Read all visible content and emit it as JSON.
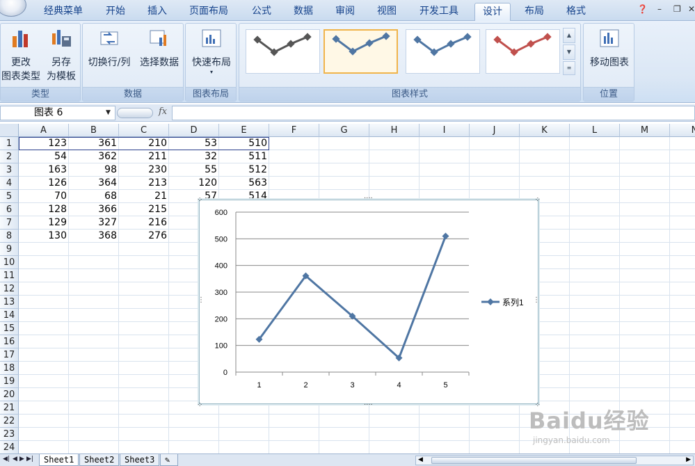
{
  "tabs": [
    "经典菜单",
    "开始",
    "插入",
    "页面布局",
    "公式",
    "数据",
    "审阅",
    "视图",
    "开发工具",
    "设计",
    "布局",
    "格式"
  ],
  "active_tab": "设计",
  "ribbon": {
    "type_group": {
      "label": "类型",
      "change_type": [
        "更改",
        "图表类型"
      ],
      "save_template": [
        "另存",
        "为模板"
      ]
    },
    "data_group": {
      "label": "数据",
      "switch_row_col": "切换行/列",
      "select_data": "选择数据"
    },
    "layout_group": {
      "label": "图表布局",
      "quick_layout": "快速布局"
    },
    "styles_group": {
      "label": "图表样式"
    },
    "location_group": {
      "label": "位置",
      "move_chart": "移动图表"
    }
  },
  "formula_bar": {
    "name_box": "图表 6",
    "fx": "fx"
  },
  "columns": [
    "A",
    "B",
    "C",
    "D",
    "E",
    "F",
    "G",
    "H",
    "I",
    "J",
    "K",
    "L",
    "M",
    "N"
  ],
  "rows": [
    "1",
    "2",
    "3",
    "4",
    "5",
    "6",
    "7",
    "8",
    "9",
    "10",
    "11",
    "12",
    "13",
    "14",
    "15",
    "16",
    "17",
    "18",
    "19",
    "20",
    "21",
    "22",
    "23",
    "24"
  ],
  "cells": [
    [
      "123",
      "361",
      "210",
      "53",
      "510"
    ],
    [
      "54",
      "362",
      "211",
      "32",
      "511"
    ],
    [
      "163",
      "98",
      "230",
      "55",
      "512"
    ],
    [
      "126",
      "364",
      "213",
      "120",
      "563"
    ],
    [
      "70",
      "68",
      "21",
      "57",
      "514"
    ],
    [
      "128",
      "366",
      "215",
      "",
      ""
    ],
    [
      "129",
      "327",
      "216",
      "",
      ""
    ],
    [
      "130",
      "368",
      "276",
      "",
      ""
    ]
  ],
  "chart_data": {
    "type": "line",
    "categories": [
      "1",
      "2",
      "3",
      "4",
      "5"
    ],
    "series": [
      {
        "name": "系列1",
        "values": [
          123,
          361,
          210,
          53,
          510
        ]
      }
    ],
    "ylim": [
      0,
      600
    ],
    "yticks": [
      "0",
      "100",
      "200",
      "300",
      "400",
      "500",
      "600"
    ],
    "grid": true,
    "legend": "right",
    "line_color": "#4f76a3"
  },
  "sheets": [
    "Sheet1",
    "Sheet2",
    "Sheet3"
  ],
  "active_sheet": "Sheet1",
  "watermark": [
    "Baidu经验",
    "jingyan.baidu.com"
  ]
}
